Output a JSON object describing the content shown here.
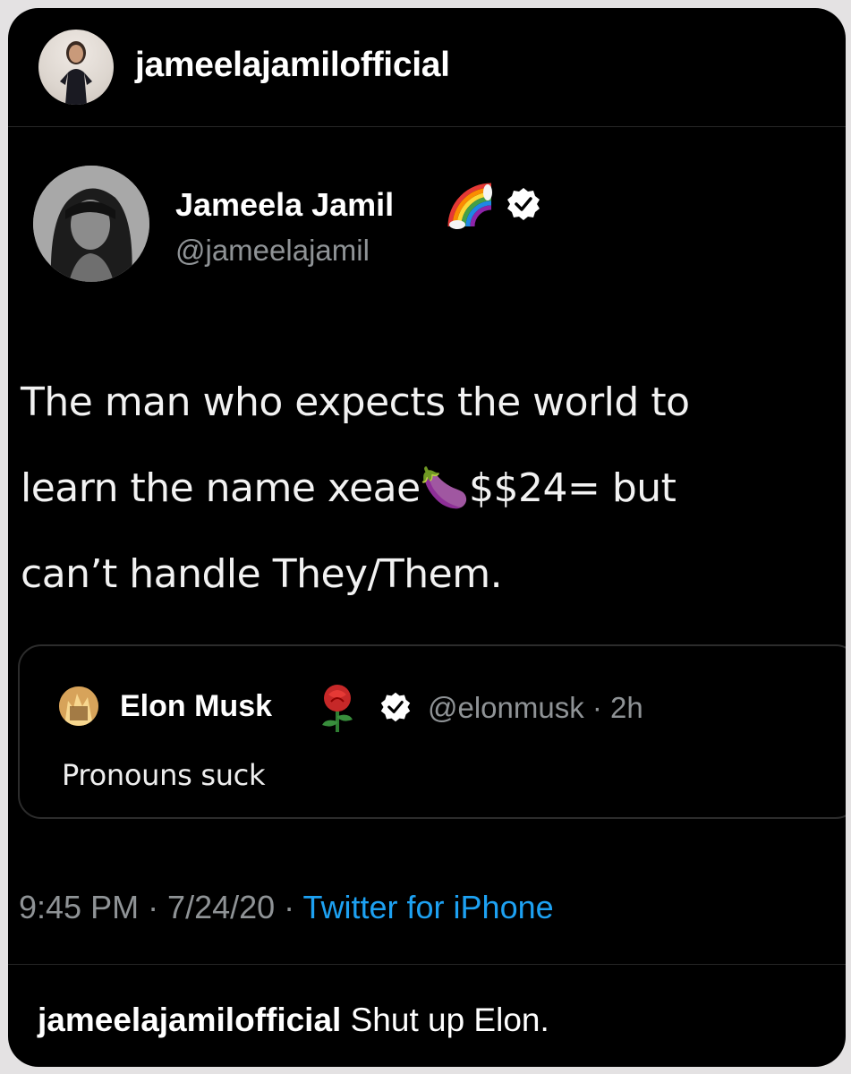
{
  "instagram": {
    "username": "jameelajamilofficial",
    "caption_username": "jameelajamilofficial",
    "caption_text": " Shut up Elon."
  },
  "tweet": {
    "display_name": "Jameela Jamil",
    "name_emoji_icon": "rainbow-icon",
    "handle": "@jameelajamil",
    "body": "The man who expects the world to\nlearn the name xeae🍆$$24= but\ncan’t handle They/Them.",
    "timestamp": "9:45 PM · 7/24/20 · ",
    "source": "Twitter for iPhone"
  },
  "quoted_tweet": {
    "display_name": "Elon Musk",
    "name_emoji_icon": "rose-icon",
    "handle_time": "@elonmusk · 2h",
    "body": "Pronouns suck"
  },
  "colors": {
    "background": "#000000",
    "frame": "#e4e2e3",
    "secondary_text": "#8f9396",
    "link": "#1da1f2",
    "verified_badge": "#ffffff"
  }
}
